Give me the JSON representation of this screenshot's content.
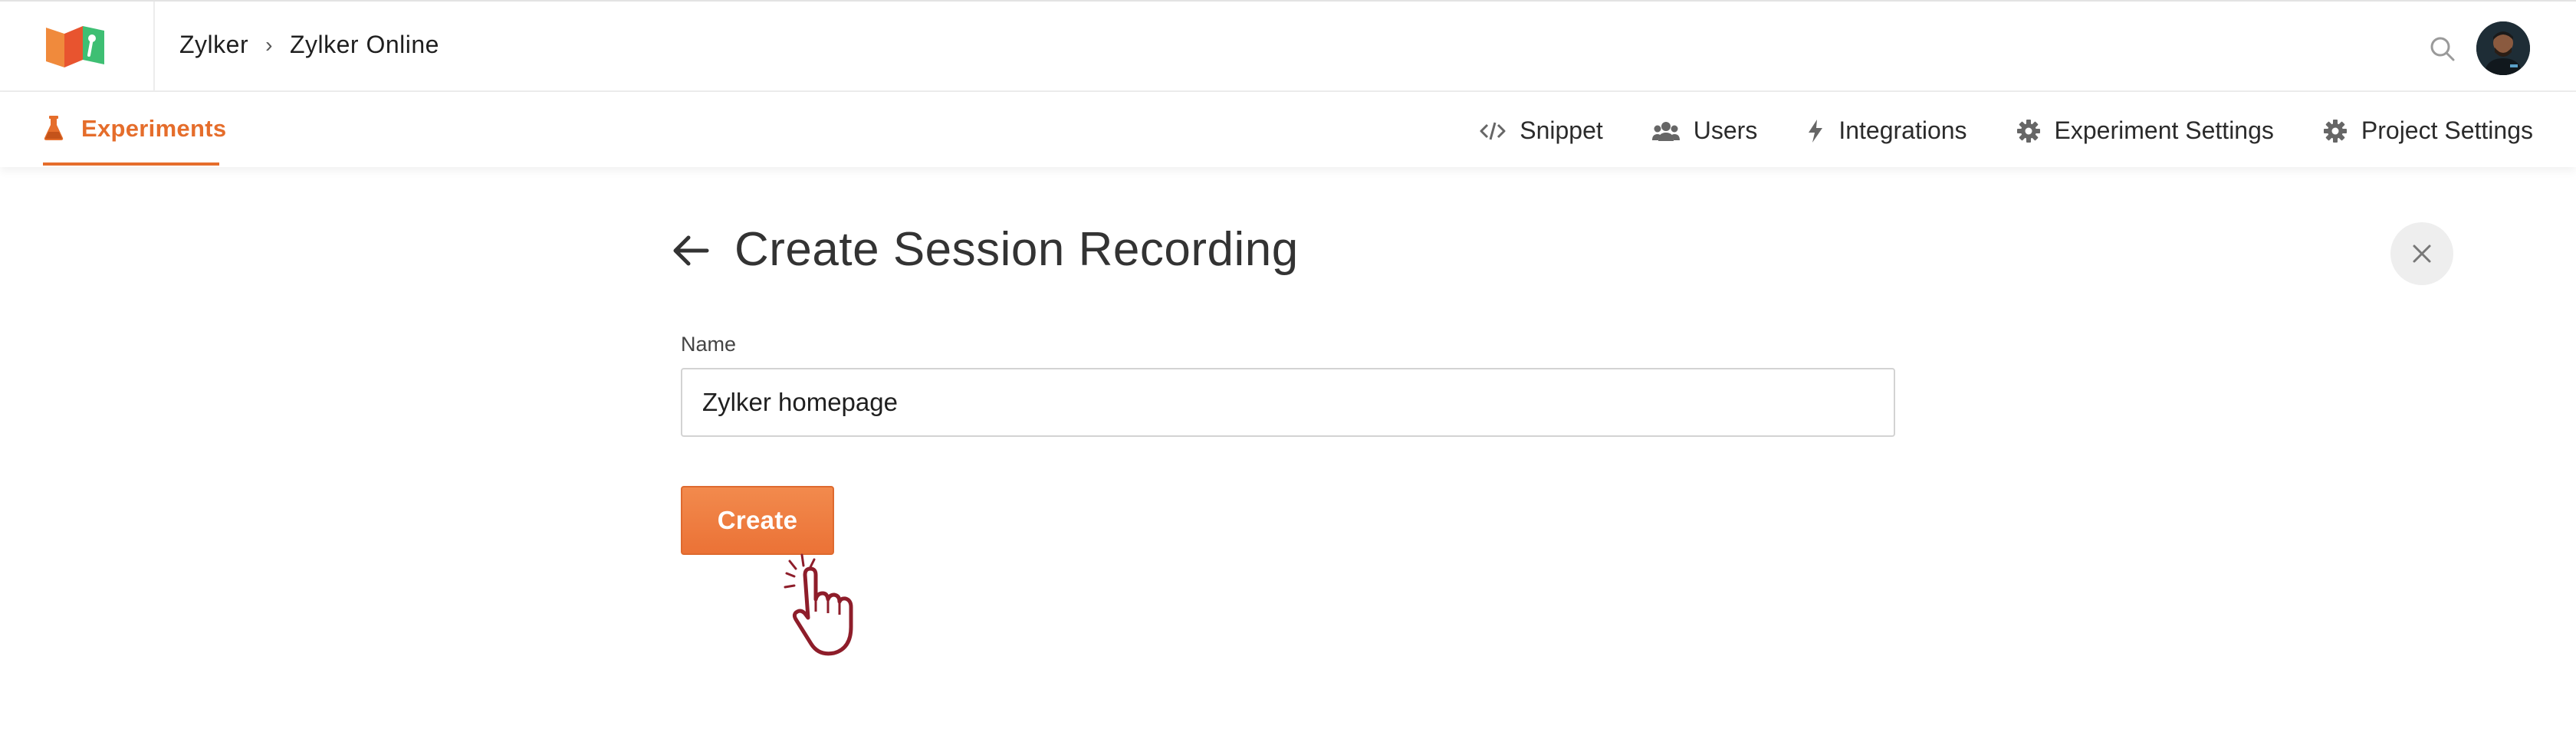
{
  "header": {
    "breadcrumb": [
      "Zylker",
      "Zylker Online"
    ],
    "breadcrumb_separator": "›",
    "icons": {
      "search": "search-icon",
      "avatar": "user-avatar"
    }
  },
  "nav": {
    "active_item": {
      "label": "Experiments",
      "icon": "flask-icon"
    },
    "items": [
      {
        "label": "Snippet",
        "icon": "code-icon"
      },
      {
        "label": "Users",
        "icon": "users-icon"
      },
      {
        "label": "Integrations",
        "icon": "lightning-icon"
      },
      {
        "label": "Experiment Settings",
        "icon": "gear-icon"
      },
      {
        "label": "Project Settings",
        "icon": "gear-icon"
      }
    ]
  },
  "page": {
    "title": "Create Session Recording",
    "name_field": {
      "label": "Name",
      "value": "Zylker homepage"
    },
    "create_label": "Create"
  },
  "colors": {
    "accent": "#e56d2b",
    "button": "#ef7c3e",
    "pointer": "#8e1d2a"
  }
}
